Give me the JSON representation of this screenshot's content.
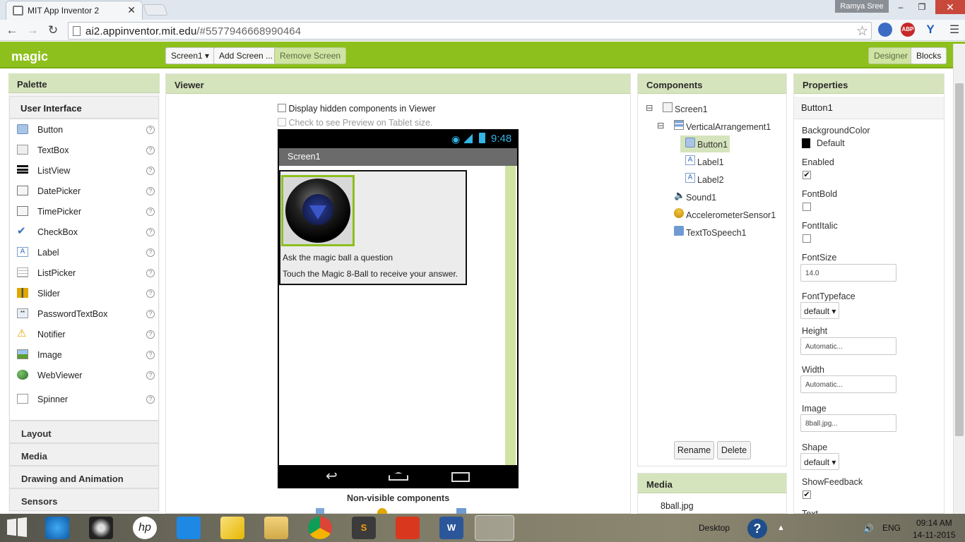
{
  "browser": {
    "tab_title": "MIT App Inventor 2",
    "tab_close": "✕",
    "user": "Ramya Sree",
    "url_host": "ai2.appinventor.mit.edu",
    "url_path": "/#5577946668990464",
    "win_min": "–",
    "win_restore": "❐",
    "win_close": "✕",
    "ext_abp": "ABP"
  },
  "app": {
    "project": "magic",
    "screen_select": "Screen1 ▾",
    "add_screen": "Add Screen ...",
    "remove_screen": "Remove Screen",
    "designer": "Designer",
    "blocks": "Blocks"
  },
  "palette": {
    "header": "Palette",
    "category_open": "User Interface",
    "items": [
      "Button",
      "TextBox",
      "ListView",
      "DatePicker",
      "TimePicker",
      "CheckBox",
      "Label",
      "ListPicker",
      "Slider",
      "PasswordTextBox",
      "Notifier",
      "Image",
      "WebViewer",
      "Spinner"
    ],
    "help": "?",
    "categories": [
      "Layout",
      "Media",
      "Drawing and Animation",
      "Sensors"
    ]
  },
  "viewer": {
    "header": "Viewer",
    "show_hidden": "Display hidden components in Viewer",
    "tablet_preview": "Check to see Preview on Tablet size.",
    "time": "9:48",
    "screen_title": "Screen1",
    "label1": "Ask the magic ball a question",
    "label2": "Touch the Magic 8-Ball to receive your answer.",
    "nonvisible": "Non-visible components"
  },
  "components": {
    "header": "Components",
    "tree": {
      "screen": "Screen1",
      "arrangement": "VerticalArrangement1",
      "button": "Button1",
      "label1": "Label1",
      "label2": "Label2",
      "sound": "Sound1",
      "accel": "AccelerometerSensor1",
      "tts": "TextToSpeech1"
    },
    "collapse": "⊟",
    "rename": "Rename",
    "delete": "Delete"
  },
  "media": {
    "header": "Media",
    "files": [
      "8ball.jpg"
    ]
  },
  "properties": {
    "header": "Properties",
    "selected": "Button1",
    "background_color_label": "BackgroundColor",
    "background_color_value": "Default",
    "enabled_label": "Enabled",
    "fontbold_label": "FontBold",
    "fontitalic_label": "FontItalic",
    "fontsize_label": "FontSize",
    "fontsize_value": "14.0",
    "typeface_label": "FontTypeface",
    "typeface_value": "default ▾",
    "height_label": "Height",
    "height_value": "Automatic...",
    "width_label": "Width",
    "width_value": "Automatic...",
    "image_label": "Image",
    "image_value": "8ball.jpg...",
    "shape_label": "Shape",
    "shape_value": "default ▾",
    "feedback_label": "ShowFeedback",
    "text_label": "Text",
    "check": "✔"
  },
  "taskbar": {
    "desktop": "Desktop",
    "lang": "ENG",
    "time": "09:14 AM",
    "date": "14-11-2015"
  },
  "colors": {
    "header_green": "#8dc01d",
    "panel_header": "#d5e4bc",
    "selected_component": "#d5e4bc"
  }
}
